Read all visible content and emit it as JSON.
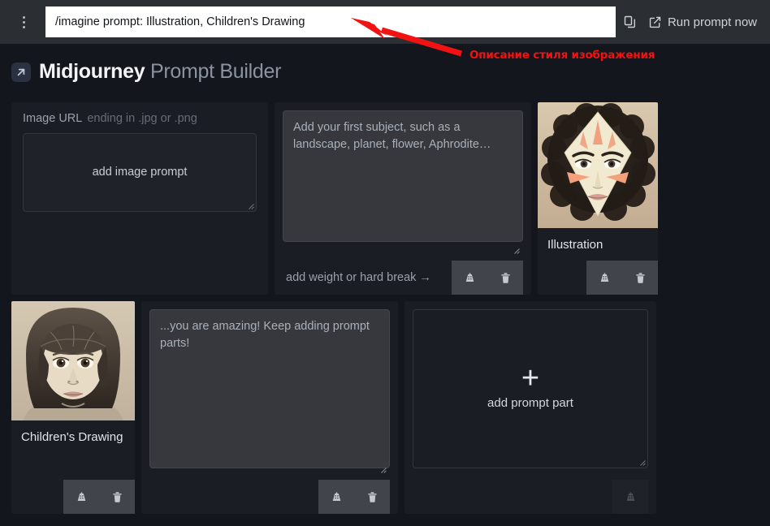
{
  "topbar": {
    "menu_icon": "kebab-menu-icon",
    "prompt_value": "/imagine prompt: Illustration, Children's Drawing",
    "prompt_placeholder": "/imagine prompt:",
    "copy_icon": "copy-icon",
    "external_link_icon": "external-link-icon",
    "run_label": "Run prompt now"
  },
  "annotation": {
    "text": "Описание стиля изображения",
    "color": "#f31212",
    "arrow": "red-arrow-pointing-to-prompt"
  },
  "header": {
    "badge_icon": "arrow-up-right-icon",
    "title_main": "Midjourney",
    "title_sub": "Prompt Builder"
  },
  "cards": {
    "image_url": {
      "label": "Image URL",
      "hint": "ending in .jpg or .png",
      "box_label": "add image prompt",
      "resize_handle": "resize-grip"
    },
    "subject": {
      "placeholder": "Add your first subject, such as a landscape, planet, flower, Aphrodite…",
      "footer_label": "add weight or hard break →",
      "weight_icon": "weight-icon",
      "trash_icon": "trash-icon"
    },
    "illustration": {
      "caption": "Illustration",
      "weight_icon": "weight-icon",
      "trash_icon": "trash-icon"
    },
    "childrens_drawing": {
      "caption": "Children's Drawing",
      "weight_icon": "weight-icon",
      "trash_icon": "trash-icon"
    },
    "amazing": {
      "placeholder": "...you are amazing! Keep adding prompt parts!",
      "weight_icon": "weight-icon",
      "trash_icon": "trash-icon"
    },
    "add_part": {
      "plus": "+",
      "label": "add prompt part",
      "weight_icon": "weight-icon"
    }
  },
  "colors": {
    "page_bg": "#13161c",
    "topbar_bg": "#2b2e33",
    "card_bg": "#1a1d24",
    "textarea_bg": "#36383d",
    "accent_red": "#f31212",
    "brand_badge": "#2a3141"
  }
}
